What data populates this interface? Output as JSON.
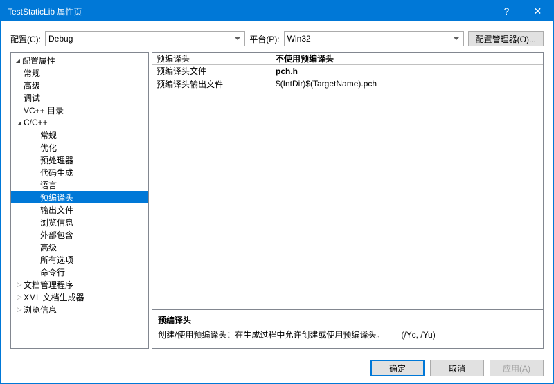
{
  "window": {
    "title": "TestStaticLib 属性页"
  },
  "toolbar": {
    "config_label": "配置(C):",
    "config_value": "Debug",
    "platform_label": "平台(P):",
    "platform_value": "Win32",
    "manager_button": "配置管理器(O)..."
  },
  "tree": {
    "root": "配置属性",
    "items1": [
      "常规",
      "高级",
      "调试",
      "VC++ 目录"
    ],
    "cpp": "C/C++",
    "cpp_items": [
      "常规",
      "优化",
      "预处理器",
      "代码生成",
      "语言",
      "预编译头",
      "输出文件",
      "浏览信息",
      "外部包含",
      "高级",
      "所有选项",
      "命令行"
    ],
    "items2": [
      "文档管理程序",
      "XML 文档生成器",
      "浏览信息"
    ]
  },
  "grid": {
    "rows": [
      {
        "name": "预编译头",
        "value": "不使用预编译头"
      },
      {
        "name": "预编译头文件",
        "value": "pch.h"
      },
      {
        "name": "预编译头输出文件",
        "value": "$(IntDir)$(TargetName).pch"
      }
    ]
  },
  "desc": {
    "title": "预编译头",
    "text": "创建/使用预编译头：在生成过程中允许创建或使用预编译头。",
    "switch": "(/Yc, /Yu)"
  },
  "buttons": {
    "ok": "确定",
    "cancel": "取消",
    "apply": "应用(A)"
  }
}
